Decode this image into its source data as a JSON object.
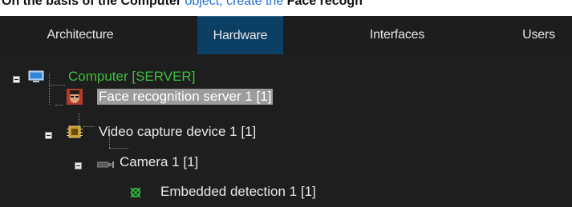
{
  "instruction": {
    "prefix": "On the basis of the ",
    "object_name": "Computer",
    "middle": " object, create the ",
    "target": "Face recogn"
  },
  "tabs": [
    {
      "label": "Architecture",
      "active": false
    },
    {
      "label": "Hardware",
      "active": true
    },
    {
      "label": "Interfaces",
      "active": false
    },
    {
      "label": "Users",
      "active": false
    }
  ],
  "tree": {
    "computer": {
      "label": "Computer [SERVER]",
      "icon": "monitor-icon",
      "color": "#3fbf3f"
    },
    "face_server": {
      "label": "Face recognition server 1 [1]",
      "icon": "face-avatar-icon",
      "selected": true
    },
    "video_capture": {
      "label": "Video capture device 1 [1]",
      "icon": "chip-icon"
    },
    "camera": {
      "label": "Camera 1 [1]",
      "icon": "camera-icon"
    },
    "embedded_detection": {
      "label": "Embedded detection 1 [1]",
      "icon": "detection-icon"
    }
  },
  "colors": {
    "background": "#1e1e1e",
    "active_tab": "#0b3f63",
    "selection": "#9c9c9c",
    "link": "#1f6fd1"
  }
}
